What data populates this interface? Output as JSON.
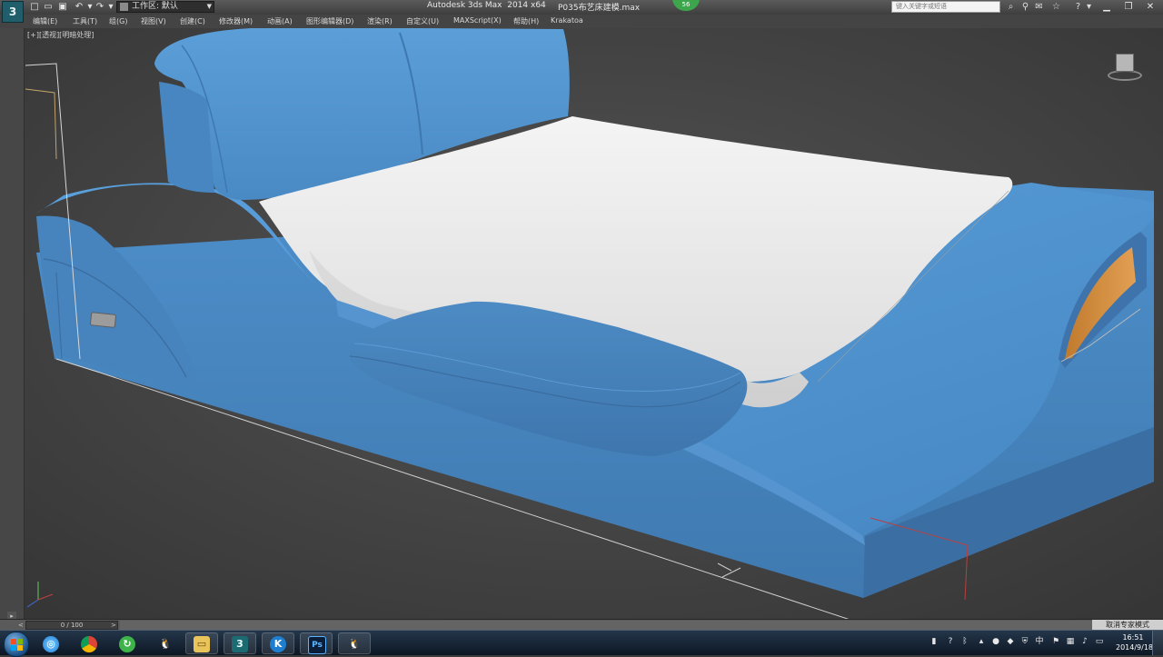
{
  "title_bar": {
    "workspace_label": "工作区: 默认",
    "app_title": "Autodesk 3ds Max  2014 x64",
    "file_title": "P035布艺床建模.max",
    "badge": "56",
    "search_placeholder": "键入关键字或短语"
  },
  "menu": [
    {
      "label": "编辑(E)"
    },
    {
      "label": "工具(T)"
    },
    {
      "label": "组(G)"
    },
    {
      "label": "视图(V)"
    },
    {
      "label": "创建(C)"
    },
    {
      "label": "修改器(M)"
    },
    {
      "label": "动画(A)"
    },
    {
      "label": "图形编辑器(D)"
    },
    {
      "label": "渲染(R)"
    },
    {
      "label": "自定义(U)"
    },
    {
      "label": "MAXScript(X)"
    },
    {
      "label": "帮助(H)"
    },
    {
      "label": "Krakatoa"
    }
  ],
  "viewport": {
    "label": "[+][透视][明暗处理]"
  },
  "timeline": {
    "frame": "0 / 100",
    "expert_mode": "取消专家模式"
  },
  "clock": {
    "time": "16:51",
    "date": "2014/9/18"
  },
  "icons": {
    "new": "new-file-icon",
    "open": "open-file-icon",
    "save": "save-icon",
    "undo": "undo-icon",
    "redo": "redo-icon",
    "viewcube": "viewcube-icon"
  },
  "colors": {
    "bed_blue": "#4d8cc5",
    "mattress": "#e9e9e9",
    "shelf_orange": "#d58d3c",
    "viewport_bg": "#404040"
  }
}
